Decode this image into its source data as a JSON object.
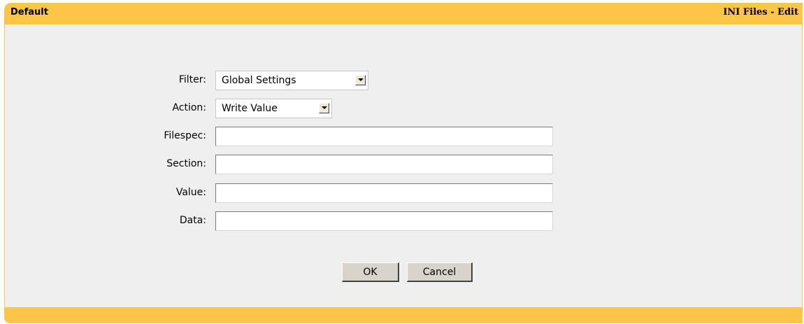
{
  "header": {
    "title_left": "Default",
    "title_right": "INI Files - Edit"
  },
  "form": {
    "filter": {
      "label": "Filter:",
      "value": "Global Settings"
    },
    "action": {
      "label": "Action:",
      "value": "Write Value"
    },
    "filespec": {
      "label": "Filespec:",
      "value": ""
    },
    "section": {
      "label": "Section:",
      "value": ""
    },
    "value": {
      "label": "Value:",
      "value": ""
    },
    "data": {
      "label": "Data:",
      "value": ""
    }
  },
  "buttons": {
    "ok_label": "OK",
    "cancel_label": "Cancel"
  },
  "colors": {
    "accent": "#fbc547",
    "panel": "#efefef"
  }
}
